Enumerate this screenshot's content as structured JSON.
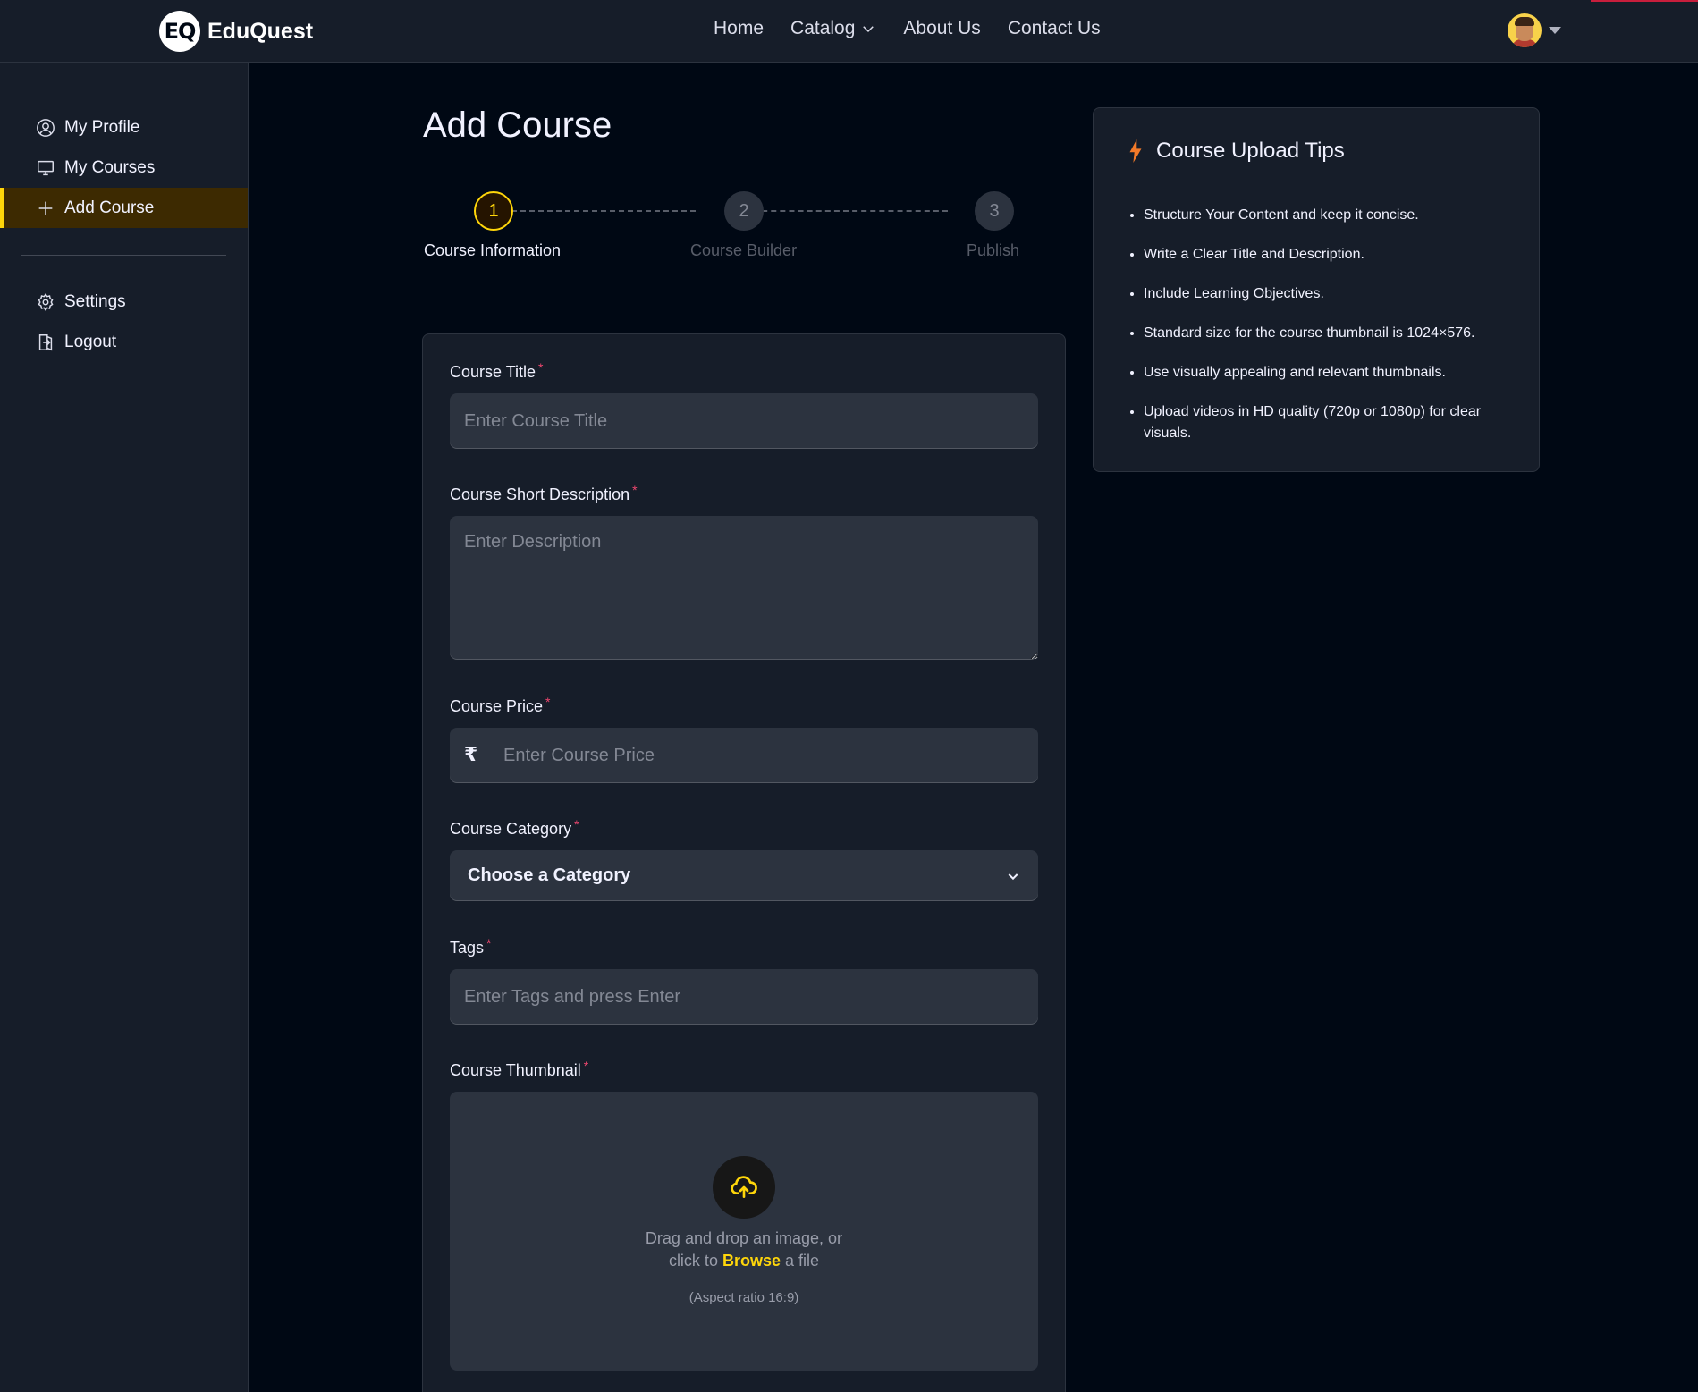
{
  "brand": {
    "logo_mark": "EQ",
    "name": "EduQuest"
  },
  "nav": {
    "home": "Home",
    "catalog": "Catalog",
    "about": "About Us",
    "contact": "Contact Us"
  },
  "sidebar": {
    "items": [
      {
        "label": "My Profile",
        "icon": "user-circle-icon"
      },
      {
        "label": "My Courses",
        "icon": "monitor-icon"
      },
      {
        "label": "Add Course",
        "icon": "plus-icon",
        "active": true
      }
    ],
    "bottom_items": [
      {
        "label": "Settings",
        "icon": "gear-icon"
      },
      {
        "label": "Logout",
        "icon": "logout-icon"
      }
    ]
  },
  "page": {
    "title": "Add Course"
  },
  "stepper": {
    "steps": [
      {
        "number": "1",
        "label": "Course Information",
        "state": "active"
      },
      {
        "number": "2",
        "label": "Course Builder",
        "state": "idle"
      },
      {
        "number": "3",
        "label": "Publish",
        "state": "idle"
      }
    ]
  },
  "form": {
    "required_mark": "*",
    "title": {
      "label": "Course Title",
      "placeholder": "Enter Course Title",
      "value": ""
    },
    "short_description": {
      "label": "Course Short Description",
      "placeholder": "Enter Description",
      "value": ""
    },
    "price": {
      "label": "Course Price",
      "currency_symbol": "₹",
      "placeholder": "Enter Course Price",
      "value": ""
    },
    "category": {
      "label": "Course Category",
      "selected": "Choose a Category"
    },
    "tags": {
      "label": "Tags",
      "placeholder": "Enter Tags and press Enter",
      "value": ""
    },
    "thumbnail": {
      "label": "Course Thumbnail",
      "line1": "Drag and drop an image, or",
      "line2_prefix": "click to",
      "browse": "Browse",
      "line2_suffix": "a file",
      "aspect": "(Aspect ratio 16:9)"
    }
  },
  "tips": {
    "title": "Course Upload Tips",
    "items": [
      "Structure Your Content and keep it concise.",
      "Write a Clear Title and Description.",
      "Include Learning Objectives.",
      "Standard size for the course thumbnail is 1024×576.",
      "Use visually appealing and relevant thumbnails.",
      "Upload videos in HD quality (720p or 1080p) for clear visuals."
    ]
  },
  "colors": {
    "background": "#000814",
    "panel": "#161D29",
    "input": "#2C333F",
    "accent": "#FFD60A",
    "required": "#EF476F",
    "tip_icon": "#F37A29"
  }
}
